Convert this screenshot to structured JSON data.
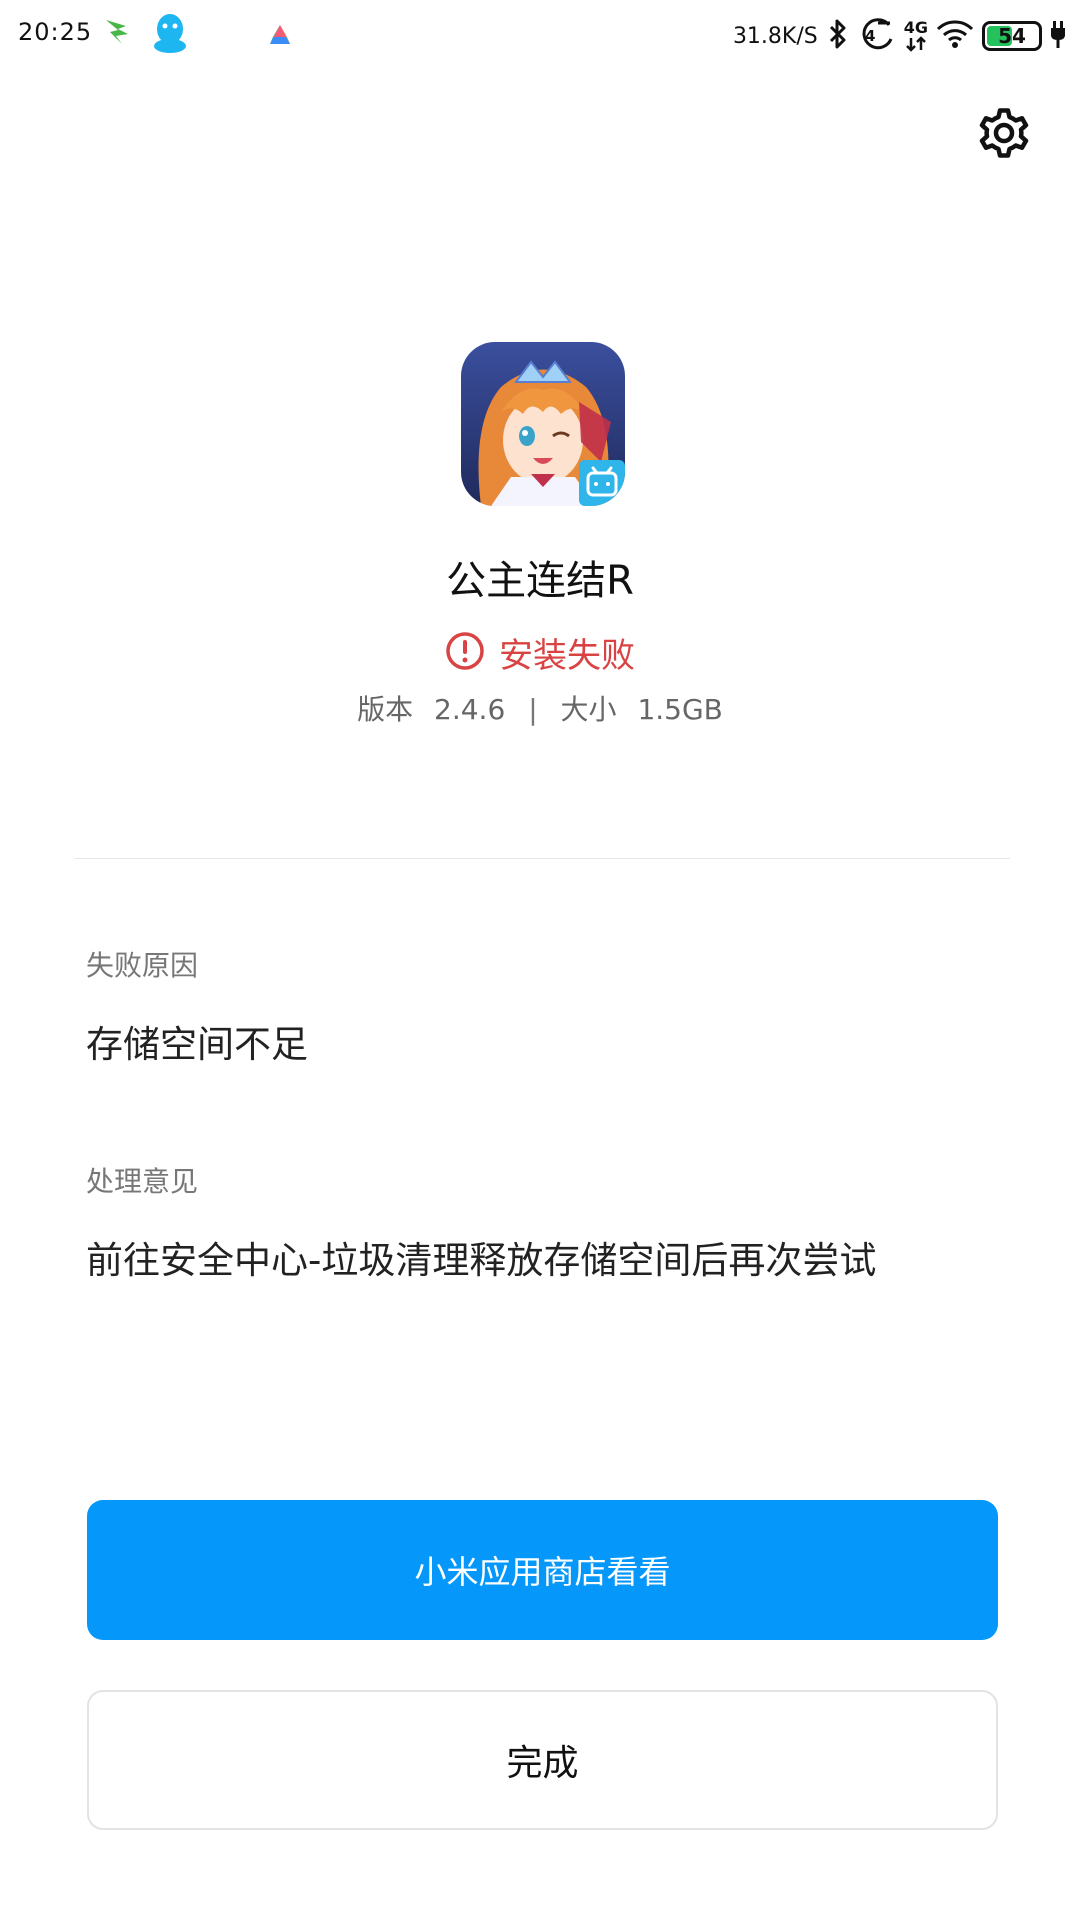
{
  "status_bar": {
    "time": "20:25",
    "network_speed": "31.8K/S",
    "signal_label": "4G",
    "battery_level": "54",
    "battery_percent": 54,
    "notification_icons": [
      "leaf-app-icon",
      "qq-penguin-icon",
      "drive-app-icon"
    ],
    "icons": [
      "bluetooth-icon",
      "volte-icon",
      "signal-4g-icon",
      "wifi-icon",
      "battery-icon",
      "charging-plug-icon"
    ]
  },
  "header": {
    "settings_icon": "gear-icon"
  },
  "app": {
    "name": "公主连结R",
    "status": "安装失败",
    "status_color": "#d94343",
    "version_label": "版本",
    "version": "2.4.6",
    "separator": "|",
    "size_label": "大小",
    "size": "1.5GB"
  },
  "failure": {
    "reason_label": "失败原因",
    "reason": "存储空间不足",
    "suggestion_label": "处理意见",
    "suggestion": "前往安全中心-垃圾清理释放存储空间后再次尝试"
  },
  "actions": {
    "primary_label": "小米应用商店看看",
    "primary_color": "#0598fa",
    "done_label": "完成"
  }
}
